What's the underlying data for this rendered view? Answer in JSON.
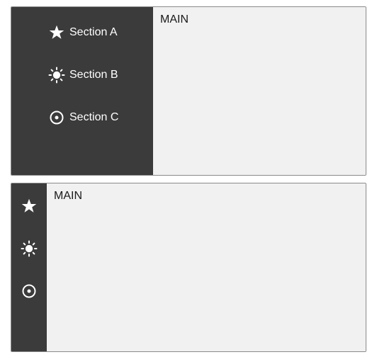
{
  "expanded": {
    "nav": [
      {
        "label": "Section A",
        "icon": "star-icon"
      },
      {
        "label": "Section B",
        "icon": "sun-icon"
      },
      {
        "label": "Section C",
        "icon": "target-icon"
      }
    ],
    "main_title": "MAIN"
  },
  "collapsed": {
    "nav": [
      {
        "icon": "star-icon"
      },
      {
        "icon": "sun-icon"
      },
      {
        "icon": "target-icon"
      }
    ],
    "main_title": "MAIN"
  },
  "colors": {
    "sidebar": "#3b3b3b",
    "main_bg": "#f1f1f1",
    "icon_text": "#ffffff"
  }
}
